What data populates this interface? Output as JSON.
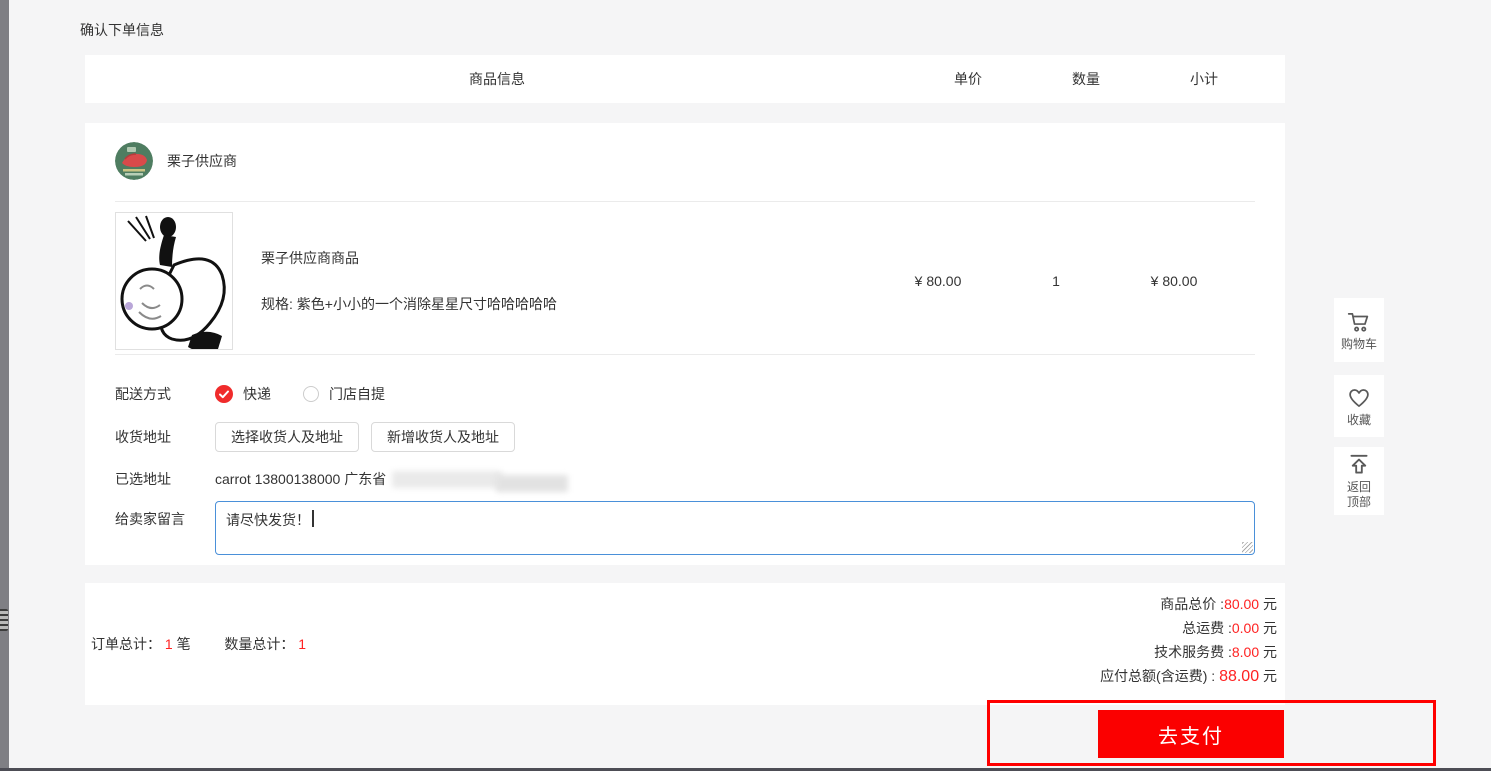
{
  "page": {
    "title": "确认下单信息"
  },
  "table": {
    "headers": [
      "商品信息",
      "单价",
      "数量",
      "小计"
    ]
  },
  "supplier": {
    "name": "栗子供应商"
  },
  "product": {
    "name": "栗子供应商商品",
    "spec": "规格: 紫色+小小的一个消除星星尺寸哈哈哈哈哈",
    "unit_price": "¥ 80.00",
    "quantity": "1",
    "subtotal": "¥ 80.00"
  },
  "form": {
    "delivery_label": "配送方式",
    "delivery_options": [
      {
        "label": "快递",
        "selected": true
      },
      {
        "label": "门店自提",
        "selected": false
      }
    ],
    "address_label": "收货地址",
    "select_address_button": "选择收货人及地址",
    "add_address_button": "新增收货人及地址",
    "selected_address_label": "已选地址",
    "selected_address_value": "carrot 13800138000 广东省",
    "message_label": "给卖家留言",
    "message_value": "请尽快发货！"
  },
  "summary": {
    "order_total_label": "订单总计：",
    "order_total_value": "1",
    "order_total_unit": "笔",
    "qty_total_label": "数量总计：",
    "qty_total_value": "1",
    "lines": [
      {
        "label": "商品总价 :",
        "value": "80.00",
        "unit": "元"
      },
      {
        "label": "总运费 :",
        "value": "0.00",
        "unit": "元"
      },
      {
        "label": "技术服务费 :",
        "value": "8.00",
        "unit": "元"
      },
      {
        "label": "应付总额(含运费) : ",
        "value": "88.00",
        "unit": "元"
      }
    ]
  },
  "pay": {
    "button_label": "去支付"
  },
  "sidebar": {
    "cart_label": "购物车",
    "favorite_label": "收藏",
    "back_top_line1": "返回",
    "back_top_line2": "顶部"
  },
  "colors": {
    "price_red": "#ff2222",
    "pay_button_red": "#fb0000",
    "annotation_red": "#ff0000",
    "textarea_focus_blue": "#4a90d9"
  }
}
